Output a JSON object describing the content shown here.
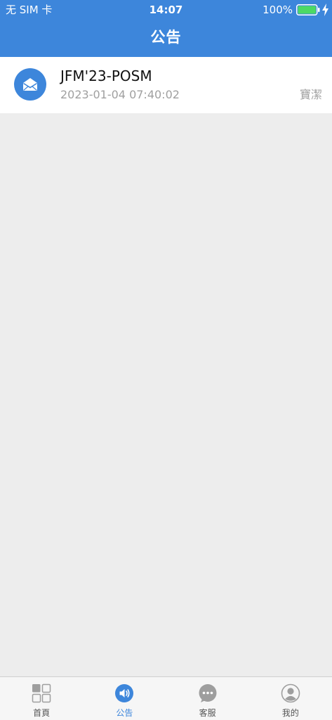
{
  "status_bar": {
    "carrier": "无 SIM 卡",
    "time": "14:07",
    "battery": "100%"
  },
  "header": {
    "title": "公告"
  },
  "announcements": [
    {
      "title": "JFM'23-POSM",
      "datetime": "2023-01-04 07:40:02",
      "author": "寶潔",
      "icon": "envelope-open-icon"
    }
  ],
  "tabs": [
    {
      "label": "首頁",
      "icon": "grid-icon",
      "active": false
    },
    {
      "label": "公告",
      "icon": "speaker-icon",
      "active": true
    },
    {
      "label": "客服",
      "icon": "chat-bubble-icon",
      "active": false
    },
    {
      "label": "我的",
      "icon": "user-icon",
      "active": false
    }
  ],
  "colors": {
    "primary": "#3d86db",
    "background": "#ededed",
    "battery": "#4cd964",
    "tab_inactive_icon": "#9e9e9e",
    "secondary_text": "#a0a0a0"
  }
}
